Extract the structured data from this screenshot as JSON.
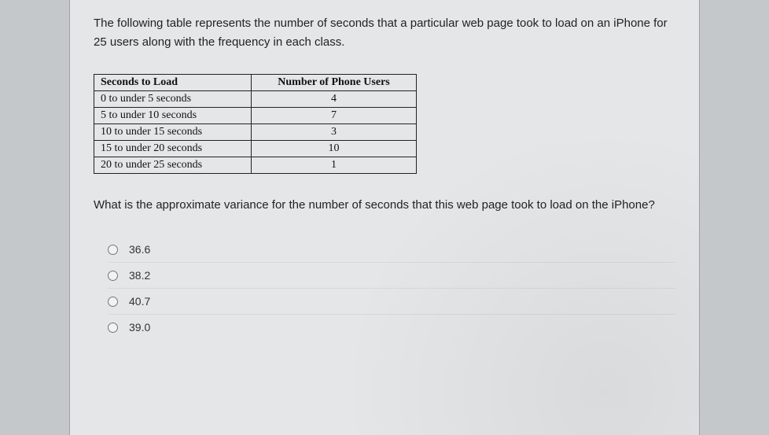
{
  "intro": "The following table represents the number of seconds that a particular web page took to load on an iPhone for 25 users along with the frequency in each class.",
  "table": {
    "header": {
      "col1": "Seconds to Load",
      "col2": "Number of Phone Users"
    },
    "rows": [
      {
        "col1": "0 to under 5 seconds",
        "col2": "4"
      },
      {
        "col1": "5 to under 10 seconds",
        "col2": "7"
      },
      {
        "col1": "10 to under 15 seconds",
        "col2": "3"
      },
      {
        "col1": "15 to under 20 seconds",
        "col2": "10"
      },
      {
        "col1": "20 to under 25 seconds",
        "col2": "1"
      }
    ]
  },
  "question": "What is the approximate variance for the number of seconds that this web page took to load on the iPhone?",
  "options": [
    {
      "label": "36.6"
    },
    {
      "label": "38.2"
    },
    {
      "label": "40.7"
    },
    {
      "label": "39.0"
    }
  ]
}
